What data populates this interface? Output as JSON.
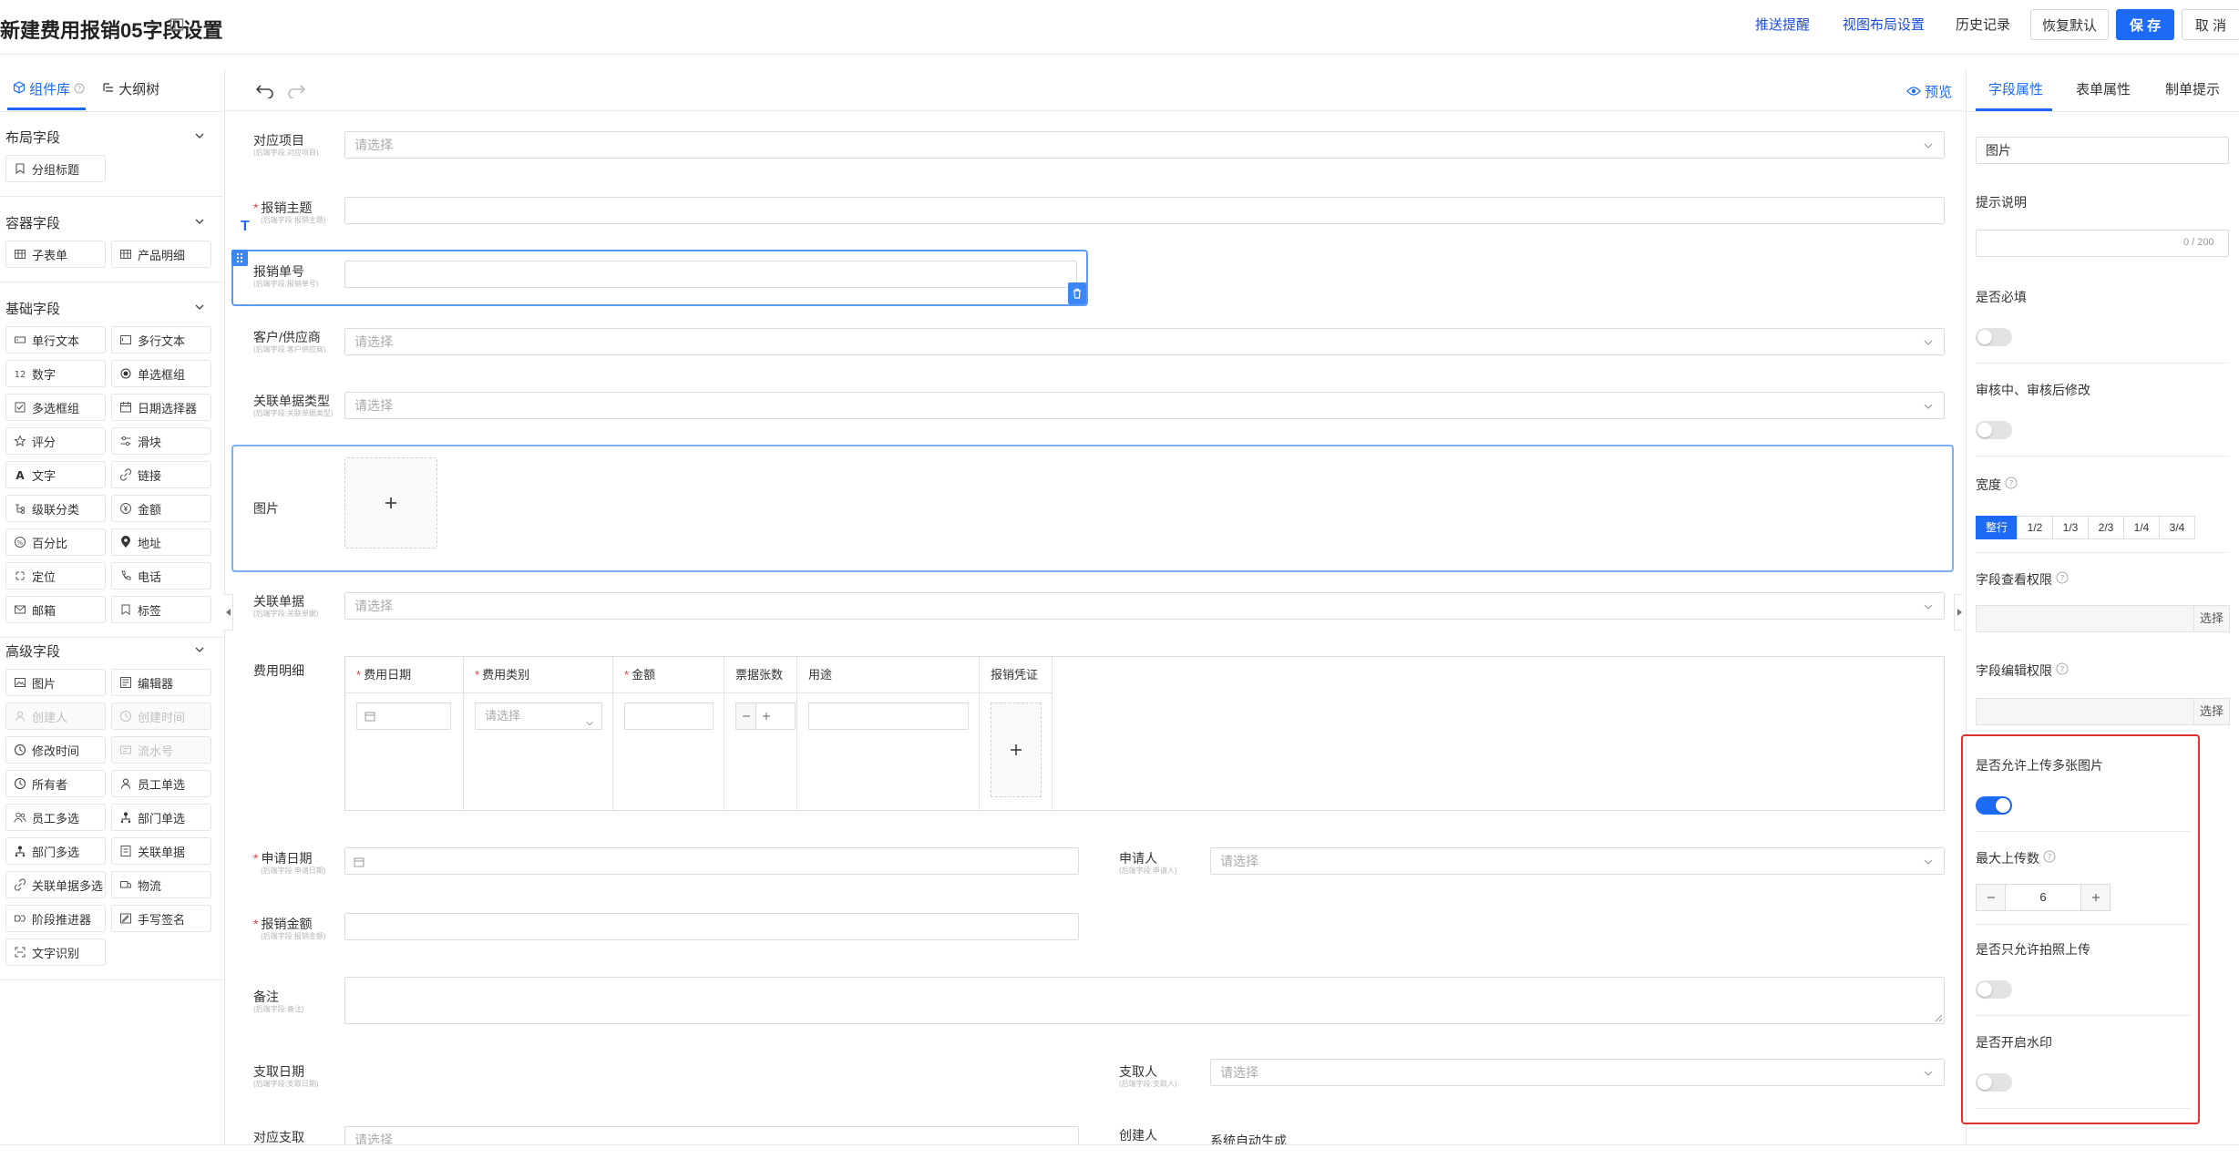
{
  "header": {
    "title": "新建费用报销05字段设置",
    "links": [
      "推送提醒",
      "视图布局设置",
      "历史记录"
    ],
    "buttons": {
      "restore": "恢复默认",
      "save": "保 存",
      "cancel": "取 消"
    }
  },
  "left": {
    "tabs": [
      "组件库",
      "大纲树"
    ],
    "sections": [
      {
        "title": "布局字段",
        "items": [
          {
            "label": "分组标题",
            "icon": "group-title-icon",
            "enabled": true
          }
        ]
      },
      {
        "title": "容器字段",
        "items": [
          {
            "label": "子表单",
            "icon": "table-icon",
            "enabled": true
          },
          {
            "label": "产品明细",
            "icon": "table-icon",
            "enabled": true
          }
        ]
      },
      {
        "title": "基础字段",
        "items": [
          {
            "label": "单行文本",
            "icon": "single-line-icon",
            "enabled": true
          },
          {
            "label": "多行文本",
            "icon": "multi-line-icon",
            "enabled": true
          },
          {
            "label": "数字",
            "icon": "number-icon",
            "enabled": true
          },
          {
            "label": "单选框组",
            "icon": "radio-icon",
            "enabled": true
          },
          {
            "label": "多选框组",
            "icon": "checkbox-icon",
            "enabled": true
          },
          {
            "label": "日期选择器",
            "icon": "calendar-icon",
            "enabled": true
          },
          {
            "label": "评分",
            "icon": "star-icon",
            "enabled": true
          },
          {
            "label": "滑块",
            "icon": "slider-icon",
            "enabled": true
          },
          {
            "label": "文字",
            "icon": "text-icon",
            "enabled": true
          },
          {
            "label": "链接",
            "icon": "link-icon",
            "enabled": true
          },
          {
            "label": "级联分类",
            "icon": "cascade-icon",
            "enabled": true
          },
          {
            "label": "金额",
            "icon": "amount-icon",
            "enabled": true
          },
          {
            "label": "百分比",
            "icon": "percent-icon",
            "enabled": true
          },
          {
            "label": "地址",
            "icon": "location-pin-icon",
            "enabled": true
          },
          {
            "label": "定位",
            "icon": "locate-icon",
            "enabled": true
          },
          {
            "label": "电话",
            "icon": "phone-icon",
            "enabled": true
          },
          {
            "label": "邮箱",
            "icon": "mail-icon",
            "enabled": true
          },
          {
            "label": "标签",
            "icon": "tag-icon",
            "enabled": true
          }
        ]
      },
      {
        "title": "高级字段",
        "items": [
          {
            "label": "图片",
            "icon": "image-icon",
            "enabled": true
          },
          {
            "label": "编辑器",
            "icon": "editor-icon",
            "enabled": true
          },
          {
            "label": "创建人",
            "icon": "user-icon",
            "enabled": false
          },
          {
            "label": "创建时间",
            "icon": "clock-icon",
            "enabled": false
          },
          {
            "label": "修改时间",
            "icon": "clock-icon",
            "enabled": true
          },
          {
            "label": "流水号",
            "icon": "serial-icon",
            "enabled": false
          },
          {
            "label": "所有者",
            "icon": "clock-icon",
            "enabled": true
          },
          {
            "label": "员工单选",
            "icon": "user-icon",
            "enabled": true
          },
          {
            "label": "员工多选",
            "icon": "users-icon",
            "enabled": true
          },
          {
            "label": "部门单选",
            "icon": "org-icon",
            "enabled": true
          },
          {
            "label": "部门多选",
            "icon": "org-icon",
            "enabled": true
          },
          {
            "label": "关联单据",
            "icon": "link-doc-icon",
            "enabled": true
          },
          {
            "label": "关联单据多选",
            "icon": "link-icon",
            "enabled": true
          },
          {
            "label": "物流",
            "icon": "logistics-icon",
            "enabled": true
          },
          {
            "label": "阶段推进器",
            "icon": "stages-icon",
            "enabled": true
          },
          {
            "label": "手写签名",
            "icon": "signature-icon",
            "enabled": true
          },
          {
            "label": "文字识别",
            "icon": "scan-icon",
            "enabled": true
          }
        ]
      }
    ]
  },
  "toolbar": {
    "preview": "预览"
  },
  "form": {
    "placeholder": "请选择",
    "fields": {
      "project": {
        "label": "对应项目",
        "sub": "(后端字段:对应项目)"
      },
      "subject": {
        "label": "报销主题",
        "sub": "(后端字段:报销主题)"
      },
      "number": {
        "label": "报销单号",
        "sub": "(后端字段:报销单号)"
      },
      "customer": {
        "label": "客户/供应商",
        "sub": "(后端字段:客户供应商)"
      },
      "doc_type": {
        "label": "关联单据类型",
        "sub": "(后端字段:关联单据类型)"
      },
      "image": {
        "label": "图片"
      },
      "doc": {
        "label": "关联单据",
        "sub": "(后端字段:关联单据)"
      },
      "detail": {
        "label": "费用明细"
      },
      "apply_date": {
        "label": "申请日期",
        "sub": "(后端字段:申请日期)"
      },
      "applicant": {
        "label": "申请人",
        "sub": "(后端字段:申请人)"
      },
      "amount": {
        "label": "报销金额",
        "sub": "(后端字段:报销金额)"
      },
      "remark": {
        "label": "备注",
        "sub": "(后端字段:备注)"
      },
      "pay_date": {
        "label": "支取日期",
        "sub": "(后端字段:支取日期)"
      },
      "payee": {
        "label": "支取人",
        "sub": "(后端字段:支取人)"
      },
      "pay": {
        "label": "对应支取"
      },
      "creator": {
        "label": "创建人",
        "value": "系统自动生成"
      }
    },
    "detail_table": {
      "columns": [
        {
          "label": "费用日期",
          "required": true
        },
        {
          "label": "费用类别",
          "required": true
        },
        {
          "label": "金额",
          "required": true
        },
        {
          "label": "票据张数",
          "required": false
        },
        {
          "label": "用途",
          "required": false
        },
        {
          "label": "报销凭证",
          "required": false
        }
      ],
      "category_placeholder": "请选择"
    }
  },
  "right": {
    "tabs": [
      "字段属性",
      "表单属性",
      "制单提示"
    ],
    "field_name": "图片",
    "hint_label": "提示说明",
    "hint_count": "0 / 200",
    "required_label": "是否必填",
    "modify_label": "审核中、审核后修改",
    "width_label": "宽度",
    "width_options": [
      "整行",
      "1/2",
      "1/3",
      "2/3",
      "1/4",
      "3/4"
    ],
    "width_selected": "整行",
    "view_perm_label": "字段查看权限",
    "edit_perm_label": "字段编辑权限",
    "choose": "选择",
    "multi_label": "是否允许上传多张图片",
    "max_label": "最大上传数",
    "max_value": "6",
    "camera_label": "是否只允许拍照上传",
    "watermark_label": "是否开启水印",
    "toggles": {
      "required": false,
      "modify": false,
      "multi": true,
      "camera": false,
      "watermark": false
    }
  },
  "colors": {
    "primary": "#1d6af5",
    "link": "#1d4fd8",
    "required": "#e43d3d",
    "highlight": "#e03030",
    "selected_border": "#5b9bf5"
  }
}
